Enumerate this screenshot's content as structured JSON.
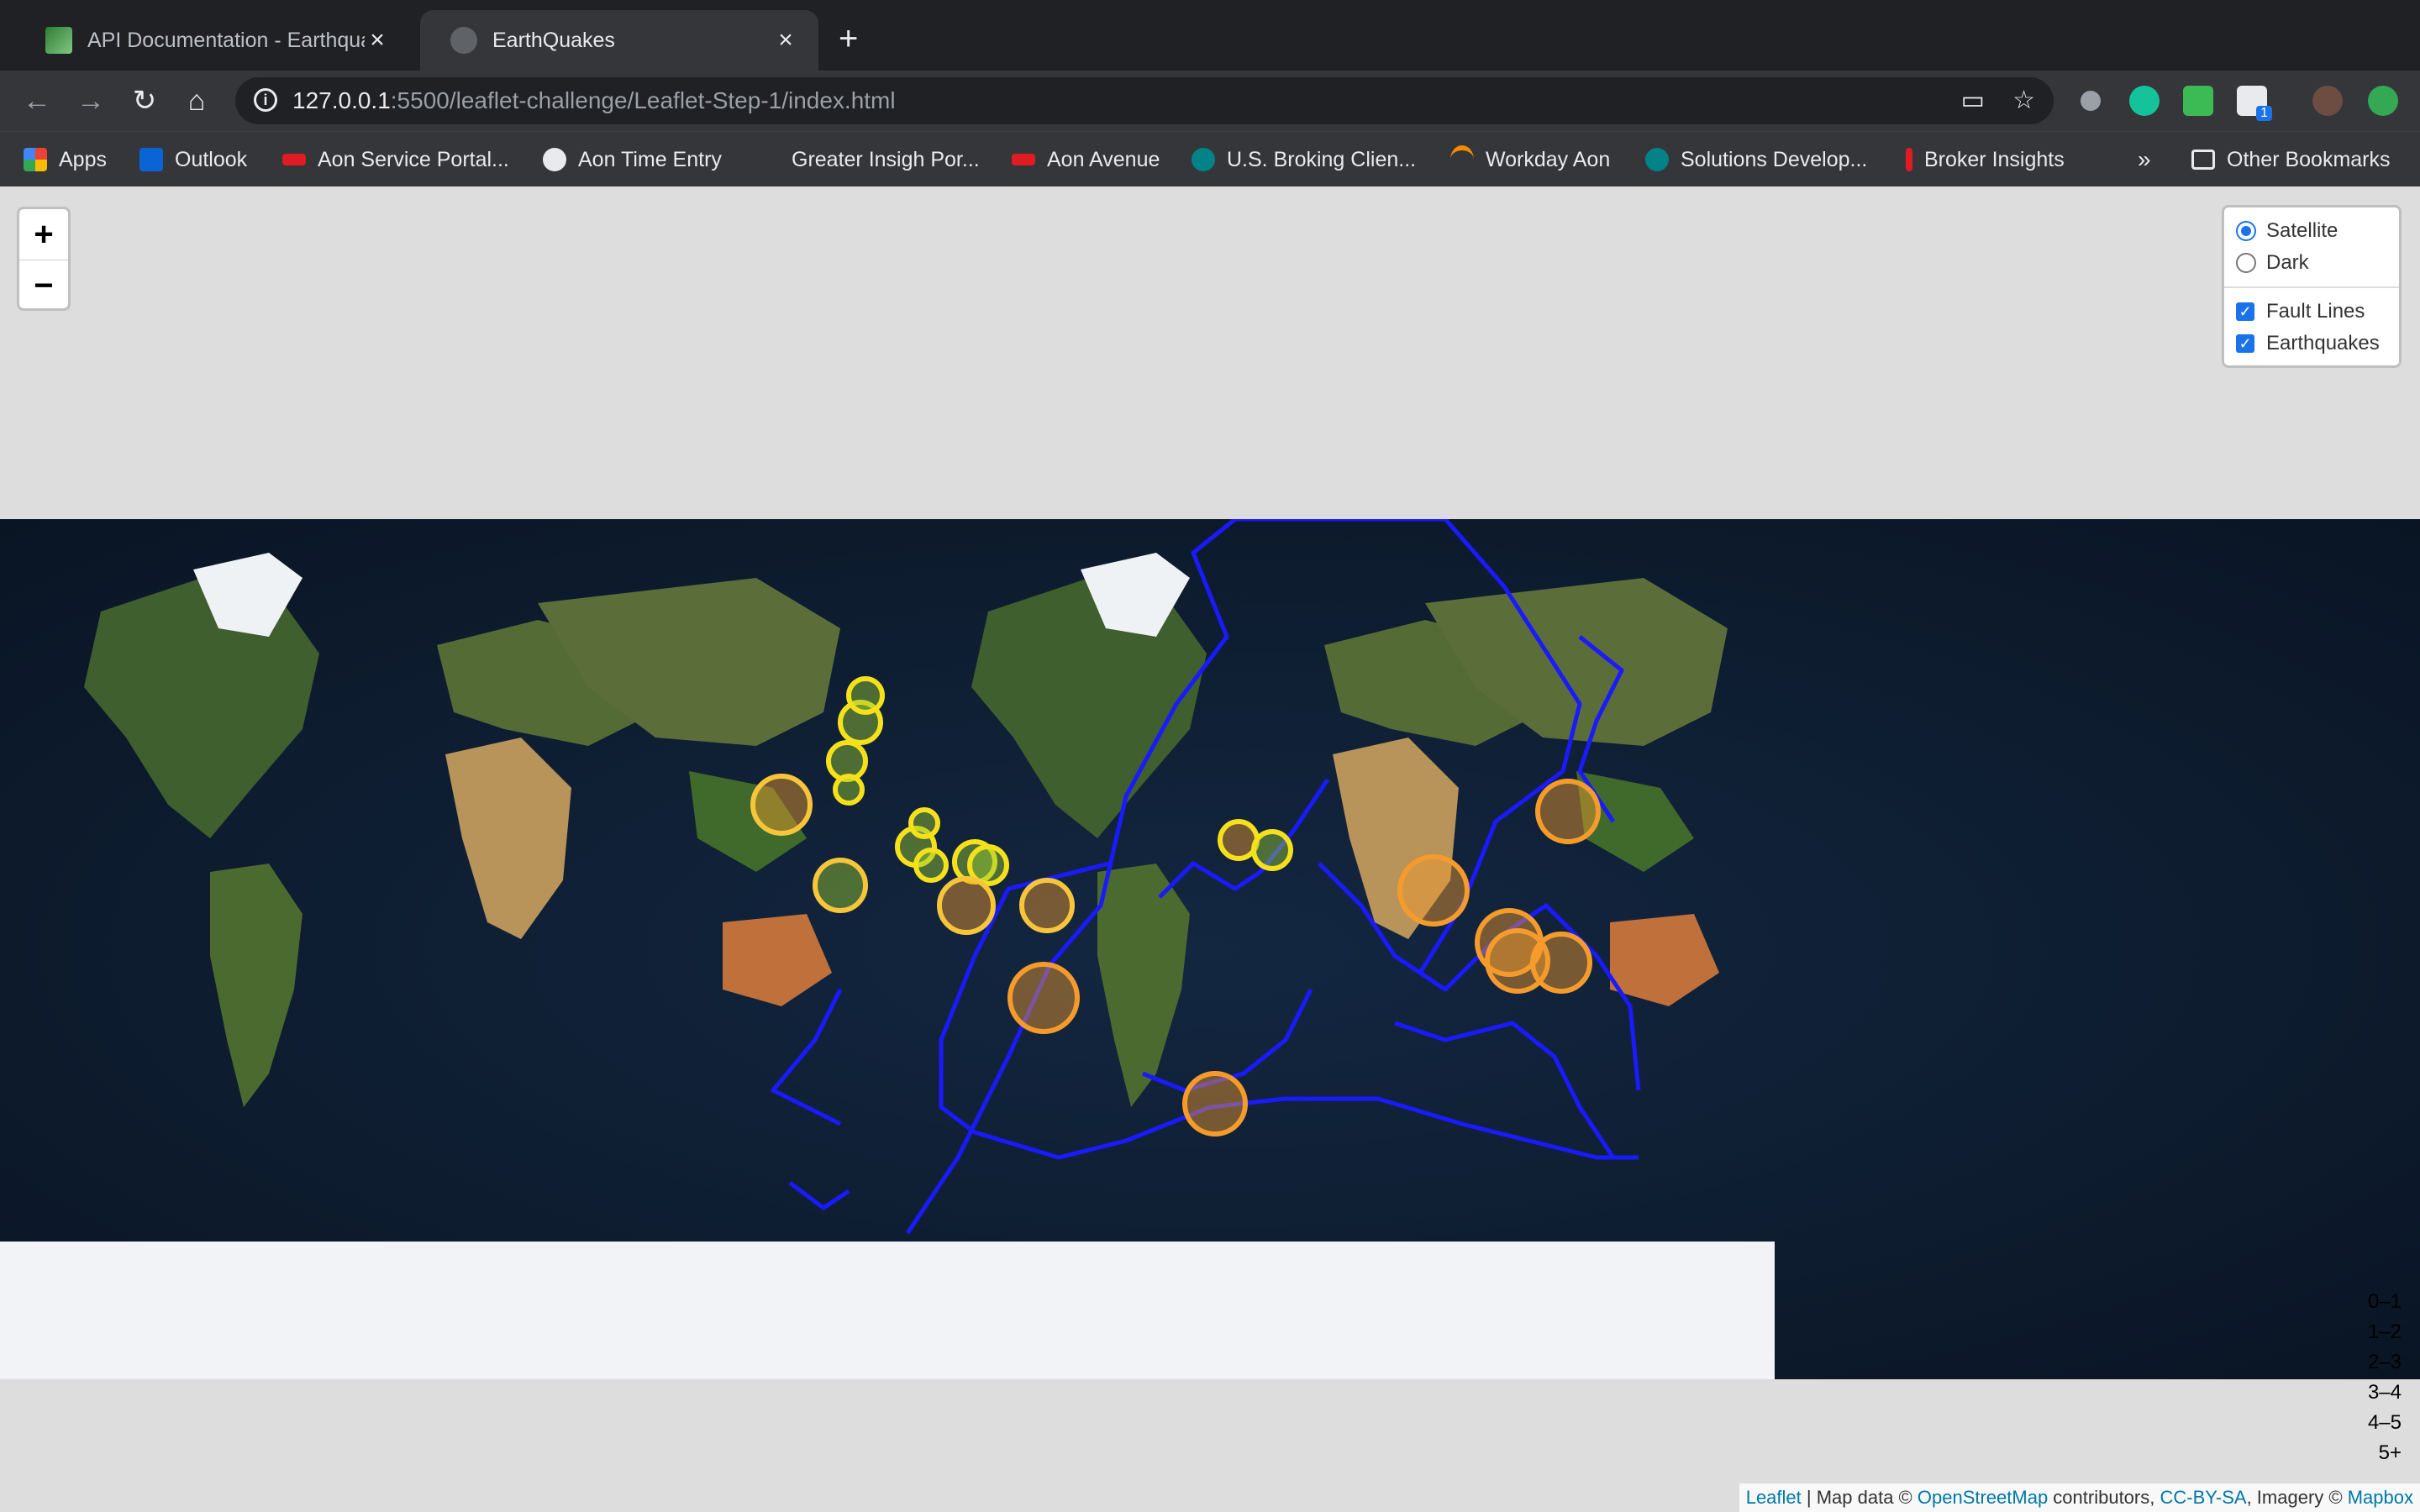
{
  "browser": {
    "tabs": [
      {
        "title": "API Documentation - Earthquak",
        "active": false
      },
      {
        "title": "EarthQuakes",
        "active": true
      }
    ],
    "url_host": "127.0.0.1",
    "url_rest": ":5500/leaflet-challenge/Leaflet-Step-1/index.html",
    "bookmarks": [
      {
        "label": "Apps",
        "icon": "apps-grid-icon"
      },
      {
        "label": "Outlook",
        "icon": "outlook-icon"
      },
      {
        "label": "Aon Service Portal...",
        "icon": "aon-icon"
      },
      {
        "label": "Aon Time Entry",
        "icon": "globe-icon"
      },
      {
        "label": "Greater Insigh Por...",
        "icon": "blank-icon"
      },
      {
        "label": "Aon Avenue",
        "icon": "aon-icon"
      },
      {
        "label": "U.S. Broking Clien...",
        "icon": "sharepoint-icon"
      },
      {
        "label": "Workday Aon",
        "icon": "workday-icon"
      },
      {
        "label": "Solutions Develop...",
        "icon": "sharepoint-icon"
      },
      {
        "label": "Broker Insights",
        "icon": "broker-icon"
      }
    ],
    "overflow": "»",
    "other_bookmarks": "Other Bookmarks",
    "extension_badge": "1"
  },
  "map": {
    "zoom_in": "+",
    "zoom_out": "−",
    "base_layers": [
      {
        "label": "Satellite",
        "selected": true
      },
      {
        "label": "Dark",
        "selected": false
      }
    ],
    "overlays": [
      {
        "label": "Fault Lines",
        "checked": true
      },
      {
        "label": "Earthquakes",
        "checked": true
      }
    ],
    "legend": [
      "0–1",
      "1–2",
      "2–3",
      "3–4",
      "4–5",
      "5+"
    ],
    "attribution": {
      "leaflet": "Leaflet",
      "sep1": " | Map data © ",
      "osm": "OpenStreetMap",
      "mid": " contributors, ",
      "ccbysa": "CC-BY-SA",
      "imagery": ", Imagery © ",
      "mapbox": "Mapbox"
    },
    "colors": {
      "fault_line": "#1a1aff",
      "mag_green": "#9acd32",
      "mag_yellow": "#f5e11b",
      "mag_gold": "#f6c53a",
      "mag_orange": "#f59b2c"
    }
  }
}
